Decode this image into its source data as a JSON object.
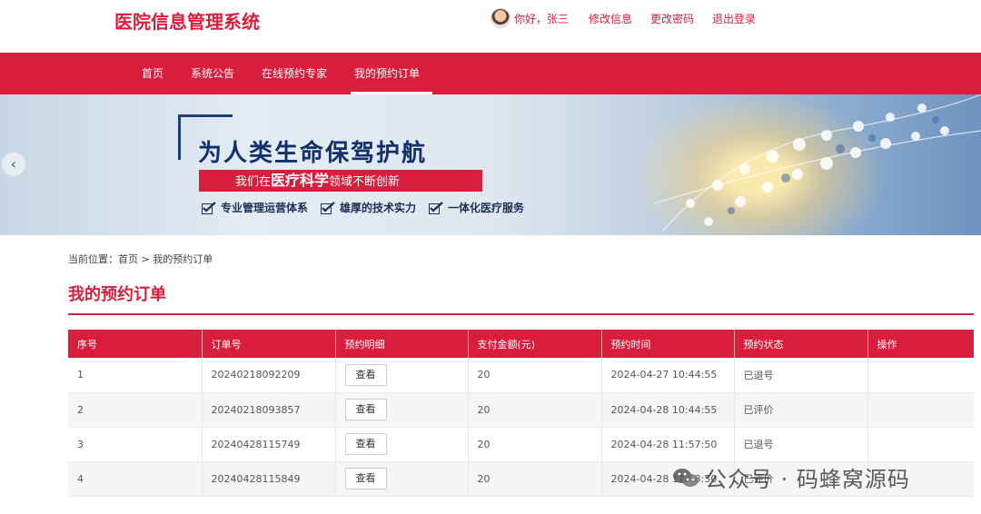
{
  "header": {
    "site_title": "医院信息管理系统",
    "greeting": "你好，张三",
    "edit_info": "修改信息",
    "change_password": "更改密码",
    "logout": "退出登录"
  },
  "nav": {
    "items": [
      {
        "label": "首页"
      },
      {
        "label": "系统公告"
      },
      {
        "label": "在线预约专家"
      },
      {
        "label": "我的预约订单"
      }
    ],
    "active_index": 3
  },
  "banner": {
    "title": "为人类生命保驾护航",
    "subtitle_pre": "我们在",
    "subtitle_strong": "医疗科学",
    "subtitle_post": "领域不断创新",
    "features": [
      "专业管理运营体系",
      "雄厚的技术实力",
      "一体化医疗服务"
    ],
    "prev_arrow": "‹"
  },
  "breadcrumb": "当前位置：首页 > 我的预约订单",
  "page_title": "我的预约订单",
  "table": {
    "headers": [
      "序号",
      "订单号",
      "预约明细",
      "支付金额(元)",
      "预约时间",
      "预约状态",
      "操作"
    ],
    "view_label": "查看",
    "rows": [
      {
        "no": "1",
        "order": "20240218092209",
        "amount": "20",
        "time": "2024-04-27 10:44:55",
        "status": "已退号"
      },
      {
        "no": "2",
        "order": "20240218093857",
        "amount": "20",
        "time": "2024-04-28 10:44:55",
        "status": "已评价"
      },
      {
        "no": "3",
        "order": "20240428115749",
        "amount": "20",
        "time": "2024-04-28 11:57:50",
        "status": "已退号"
      },
      {
        "no": "4",
        "order": "20240428115849",
        "amount": "20",
        "time": "2024-04-28 11:58:50",
        "status": "已评价"
      }
    ]
  },
  "watermark": "公众号 · 码蜂窝源码",
  "colors": {
    "brand_red": "#d81e3c",
    "banner_navy": "#13306b"
  }
}
